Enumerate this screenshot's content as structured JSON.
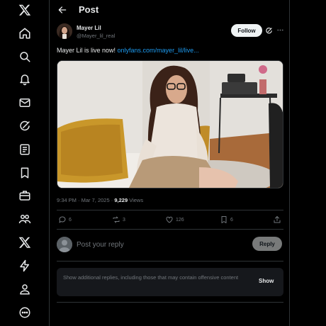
{
  "nav": {
    "items": [
      {
        "icon": "x-logo-icon"
      },
      {
        "icon": "home-icon"
      },
      {
        "icon": "search-icon"
      },
      {
        "icon": "notifications-icon"
      },
      {
        "icon": "messages-icon"
      },
      {
        "icon": "grok-icon"
      },
      {
        "icon": "lists-icon"
      },
      {
        "icon": "bookmarks-icon"
      },
      {
        "icon": "jobs-icon"
      },
      {
        "icon": "communities-icon"
      },
      {
        "icon": "premium-icon"
      },
      {
        "icon": "verified-orgs-icon"
      },
      {
        "icon": "profile-icon"
      },
      {
        "icon": "more-icon"
      }
    ]
  },
  "header": {
    "title": "Post"
  },
  "post": {
    "author_name": "Mayer Lil",
    "author_handle": "@Mayer_lil_real",
    "follow_label": "Follow",
    "text": "Mayer Lil is live now! ",
    "link_text": "onlyfans.com/mayer_lil/live...",
    "time": "9:34 PM",
    "date": "Mar 7, 2025",
    "views_count": "9,229",
    "views_label": "Views",
    "stats": {
      "replies": "6",
      "reposts": "3",
      "likes": "126",
      "bookmarks": "6"
    }
  },
  "reply": {
    "placeholder": "Post your reply",
    "button_label": "Reply"
  },
  "more_replies": {
    "text": "Show additional replies, including those that may contain offensive content",
    "button_label": "Show"
  },
  "colors": {
    "background": "#000000",
    "accent": "#1d9bf0",
    "text": "#e7e9ea",
    "muted": "#71767b",
    "border": "#2f3336"
  }
}
